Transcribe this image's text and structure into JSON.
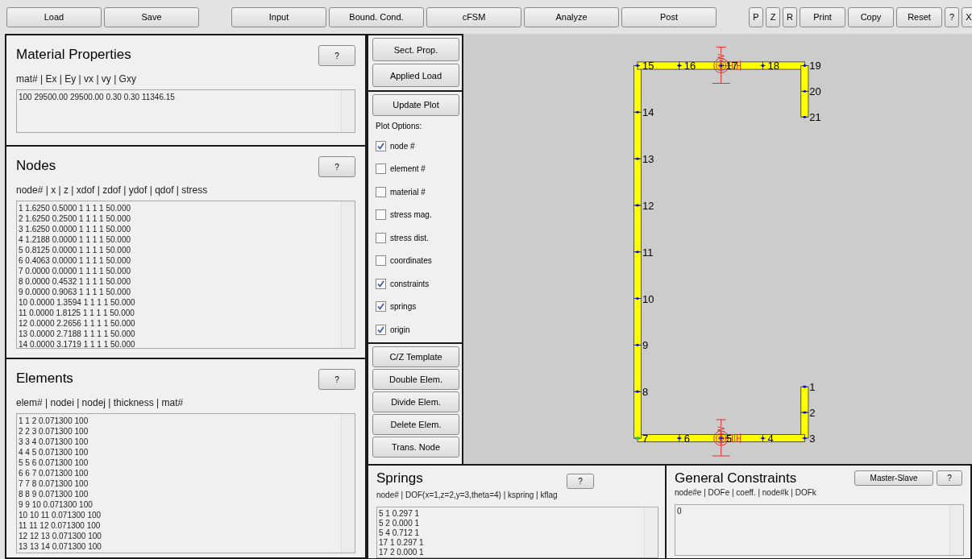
{
  "toolbar": {
    "groups": [
      [
        "Load",
        "Save"
      ],
      [
        "Input",
        "Bound. Cond.",
        "cFSM",
        "Analyze",
        "Post"
      ],
      [
        "P",
        "Z",
        "R",
        "Print",
        "Copy",
        "Reset",
        "?",
        "X"
      ]
    ]
  },
  "material_properties": {
    "title": "Material Properties",
    "help": "?",
    "header": "mat# | Ex | Ey | vx | vy | Gxy",
    "lines": [
      "100 29500.00 29500.00 0.30 0.30 11346.15"
    ]
  },
  "nodes": {
    "title": "Nodes",
    "help": "?",
    "header": "node# | x | z | xdof | zdof | ydof | qdof | stress",
    "lines": [
      "1 1.6250 0.5000 1 1 1 1 50.000",
      "2 1.6250 0.2500 1 1 1 1 50.000",
      "3 1.6250 0.0000 1 1 1 1 50.000",
      "4 1.2188 0.0000 1 1 1 1 50.000",
      "5 0.8125 0.0000 1 1 1 1 50.000",
      "6 0.4063 0.0000 1 1 1 1 50.000",
      "7 0.0000 0.0000 1 1 1 1 50.000",
      "8 0.0000 0.4532 1 1 1 1 50.000",
      "9 0.0000 0.9063 1 1 1 1 50.000",
      "10 0.0000 1.3594 1 1 1 1 50.000",
      "11 0.0000 1.8125 1 1 1 1 50.000",
      "12 0.0000 2.2656 1 1 1 1 50.000",
      "13 0.0000 2.7188 1 1 1 1 50.000",
      "14 0.0000 3.1719 1 1 1 1 50.000"
    ]
  },
  "elements": {
    "title": "Elements",
    "help": "?",
    "header": "elem# | nodei | nodej | thickness | mat#",
    "lines": [
      "1 1 2 0.071300 100",
      "2 2 3 0.071300 100",
      "3 3 4 0.071300 100",
      "4 4 5 0.071300 100",
      "5 5 6 0.071300 100",
      "6 6 7 0.071300 100",
      "7 7 8 0.071300 100",
      "8 8 9 0.071300 100",
      "9 9 10 0.071300 100",
      "10 10 11 0.071300 100",
      "11 11 12 0.071300 100",
      "12 12 13 0.071300 100",
      "13 13 14 0.071300 100"
    ]
  },
  "section_buttons": [
    "Sect. Prop.",
    "Applied Load"
  ],
  "plot_controls": {
    "update_button": "Update Plot",
    "options_label": "Plot Options:",
    "options": [
      {
        "label": "node #",
        "checked": true
      },
      {
        "label": "element #",
        "checked": false
      },
      {
        "label": "material #",
        "checked": false
      },
      {
        "label": "stress mag.",
        "checked": false
      },
      {
        "label": "stress dist.",
        "checked": false
      },
      {
        "label": "coordinates",
        "checked": false
      },
      {
        "label": "constraints",
        "checked": true
      },
      {
        "label": "springs",
        "checked": true
      },
      {
        "label": "origin",
        "checked": true
      }
    ]
  },
  "edit_buttons": [
    "C/Z Template",
    "Double Elem.",
    "Divide Elem.",
    "Delete Elem.",
    "Trans. Node"
  ],
  "plot": {
    "node_labels": [
      "15",
      "16",
      "17",
      "18",
      "19",
      "20",
      "14",
      "21",
      "13",
      "12",
      "11",
      "10",
      "9",
      "8",
      "1",
      "2",
      "7",
      "6",
      "5",
      "4",
      "3"
    ]
  },
  "springs": {
    "title": "Springs",
    "help": "?",
    "header": "node# | DOF(x=1,z=2,y=3,theta=4) | kspring | kflag",
    "lines": [
      "5 1 0.297 1",
      "5 2 0.000 1",
      "5 4 0.712 1",
      "17 1 0.297 1",
      "17 2 0.000 1"
    ]
  },
  "general_constraints": {
    "title": "General Constraints",
    "buttons": [
      "Master-Slave",
      "?"
    ],
    "header": "node#e | DOFe | coeff. | node#k | DOFk",
    "lines": [
      "0"
    ]
  }
}
